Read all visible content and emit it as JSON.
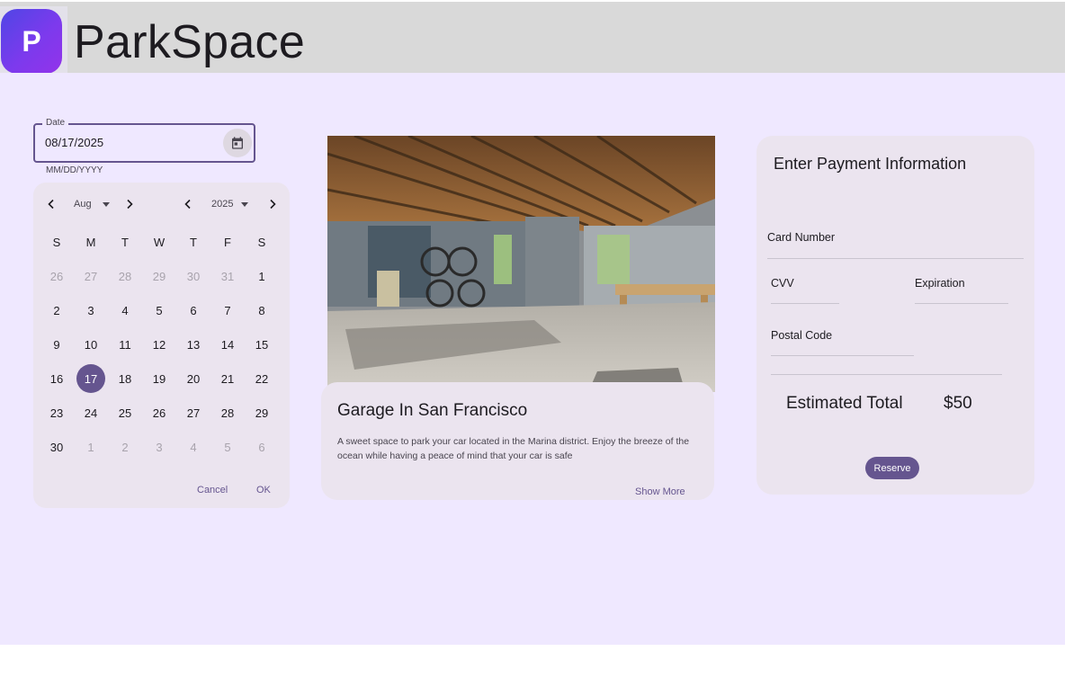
{
  "app": {
    "logo_letter": "P",
    "title": "ParkSpace"
  },
  "date_field": {
    "label": "Date",
    "value": "08/17/2025",
    "hint": "MM/DD/YYYY",
    "icon": "calendar-icon"
  },
  "picker": {
    "month": "Aug",
    "year": "2025",
    "weekdays": [
      "S",
      "M",
      "T",
      "W",
      "T",
      "F",
      "S"
    ],
    "weeks": [
      [
        {
          "d": "26",
          "muted": true
        },
        {
          "d": "27",
          "muted": true
        },
        {
          "d": "28",
          "muted": true
        },
        {
          "d": "29",
          "muted": true
        },
        {
          "d": "30",
          "muted": true
        },
        {
          "d": "31",
          "muted": true
        },
        {
          "d": "1"
        }
      ],
      [
        {
          "d": "2"
        },
        {
          "d": "3"
        },
        {
          "d": "4"
        },
        {
          "d": "5"
        },
        {
          "d": "6"
        },
        {
          "d": "7"
        },
        {
          "d": "8"
        }
      ],
      [
        {
          "d": "9"
        },
        {
          "d": "10"
        },
        {
          "d": "11"
        },
        {
          "d": "12"
        },
        {
          "d": "13"
        },
        {
          "d": "14"
        },
        {
          "d": "15"
        }
      ],
      [
        {
          "d": "16"
        },
        {
          "d": "17",
          "selected": true
        },
        {
          "d": "18"
        },
        {
          "d": "19"
        },
        {
          "d": "20"
        },
        {
          "d": "21"
        },
        {
          "d": "22"
        }
      ],
      [
        {
          "d": "23"
        },
        {
          "d": "24"
        },
        {
          "d": "25"
        },
        {
          "d": "26"
        },
        {
          "d": "27"
        },
        {
          "d": "28"
        },
        {
          "d": "29"
        }
      ],
      [
        {
          "d": "30"
        },
        {
          "d": "1",
          "muted": true
        },
        {
          "d": "2",
          "muted": true
        },
        {
          "d": "3",
          "muted": true
        },
        {
          "d": "4",
          "muted": true
        },
        {
          "d": "5",
          "muted": true
        },
        {
          "d": "6",
          "muted": true
        }
      ]
    ],
    "cancel_label": "Cancel",
    "ok_label": "OK"
  },
  "listing": {
    "title": "Garage In San Francisco",
    "description": "A sweet space to park your car located in the Marina district. Enjoy the breeze of the ocean while having a peace of mind that your car is safe",
    "show_more_label": "Show More"
  },
  "payment": {
    "title": "Enter Payment Information",
    "card_number_label": "Card Number",
    "cvv_label": "CVV",
    "expiration_label": "Expiration",
    "postal_code_label": "Postal Code",
    "total_label": "Estimated Total",
    "total_value": "$50",
    "reserve_label": "Reserve"
  },
  "colors": {
    "primary": "#65558f",
    "background": "#efe8ff",
    "surface": "#ebe4ef",
    "appbar": "#d9d9d9"
  }
}
